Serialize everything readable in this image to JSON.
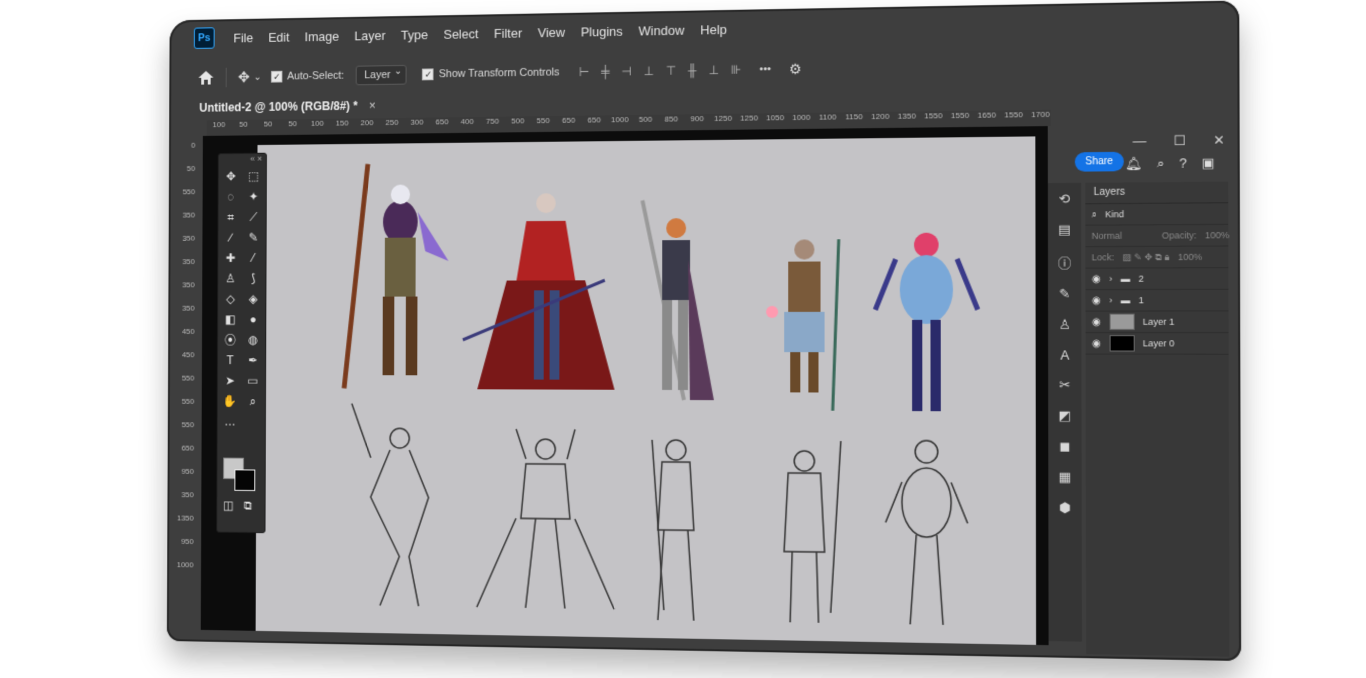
{
  "app": {
    "logo": "Ps",
    "share_label": "Share"
  },
  "menu": [
    "File",
    "Edit",
    "Image",
    "Layer",
    "Type",
    "Select",
    "Filter",
    "View",
    "Plugins",
    "Window",
    "Help"
  ],
  "options": {
    "auto_select_label": "Auto-Select:",
    "auto_select_value": "Layer",
    "show_transform_label": "Show Transform Controls",
    "more": "•••"
  },
  "document": {
    "tab_title": "Untitled-2 @ 100% (RGB/8#) *",
    "close": "×"
  },
  "rulers": {
    "top": [
      "100",
      "50",
      "50",
      "50",
      "100",
      "150",
      "200",
      "250",
      "300",
      "650",
      "400",
      "750",
      "500",
      "550",
      "650",
      "650",
      "1000",
      "500",
      "850",
      "900",
      "1250",
      "1250",
      "1050",
      "1000",
      "1100",
      "1150",
      "1200",
      "1350",
      "1550",
      "1550",
      "1650",
      "1550",
      "1700",
      "1750",
      "1800",
      "1850",
      "1900"
    ],
    "left": [
      "0",
      "50",
      "550",
      "350",
      "350",
      "350",
      "350",
      "350",
      "450",
      "450",
      "550",
      "550",
      "550",
      "650",
      "950",
      "350",
      "1350",
      "950",
      "1000"
    ]
  },
  "window_controls": {
    "minimize": "—",
    "maximize": "☐",
    "close": "✕"
  },
  "layers_panel": {
    "title": "Layers",
    "filter_kind": "Kind",
    "blend_mode": "Normal",
    "opacity_label": "Opacity:",
    "opacity_value": "100%",
    "lock_label": "Lock:",
    "fill_value": "100%",
    "layers": [
      {
        "name": "2",
        "type": "group"
      },
      {
        "name": "1",
        "type": "group"
      },
      {
        "name": "Layer 1",
        "type": "layer",
        "color": "#9a9a9a"
      },
      {
        "name": "Layer 0",
        "type": "layer",
        "color": "#000000"
      }
    ]
  }
}
